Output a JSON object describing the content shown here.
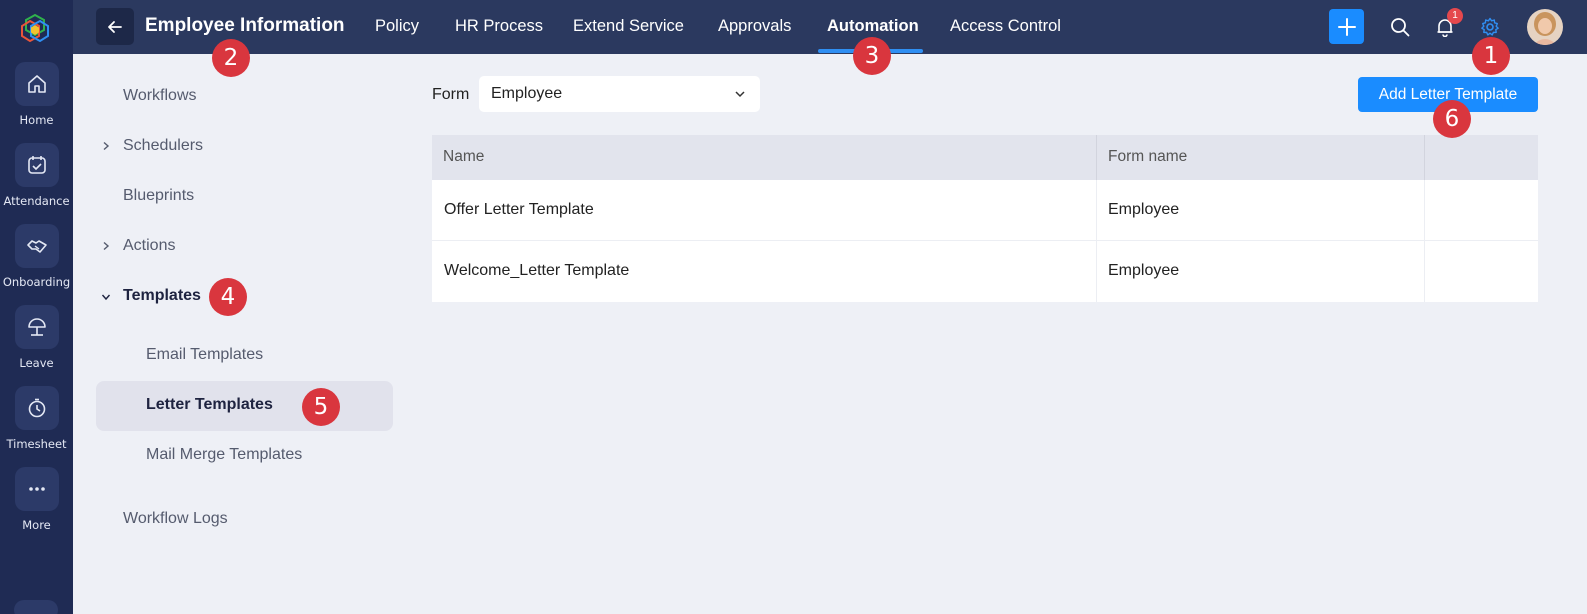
{
  "rail": {
    "items": [
      {
        "label": "Home",
        "icon": "home-icon"
      },
      {
        "label": "Attendance",
        "icon": "calendar-check-icon"
      },
      {
        "label": "Onboarding",
        "icon": "handshake-icon"
      },
      {
        "label": "Leave",
        "icon": "umbrella-icon"
      },
      {
        "label": "Timesheet",
        "icon": "stopwatch-icon"
      },
      {
        "label": "More",
        "icon": "more-dots-icon"
      }
    ]
  },
  "header": {
    "title": "Employee Information",
    "tabs": [
      {
        "label": "Policy",
        "active": false
      },
      {
        "label": "HR Process",
        "active": false
      },
      {
        "label": "Extend Service",
        "active": false
      },
      {
        "label": "Approvals",
        "active": false
      },
      {
        "label": "Automation",
        "active": true
      },
      {
        "label": "Access Control",
        "active": false
      }
    ],
    "notification_count": "1",
    "colors": {
      "bar": "#2b395f",
      "accent": "#1a8cff",
      "badge": "#e5484d"
    }
  },
  "sidebar": {
    "items": [
      {
        "label": "Workflows"
      },
      {
        "label": "Schedulers"
      },
      {
        "label": "Blueprints"
      },
      {
        "label": "Actions"
      },
      {
        "label": "Templates"
      },
      {
        "label": "Email Templates"
      },
      {
        "label": "Letter Templates"
      },
      {
        "label": "Mail Merge Templates"
      },
      {
        "label": "Workflow Logs"
      }
    ]
  },
  "filter": {
    "form_label": "Form",
    "form_value": "Employee"
  },
  "actions": {
    "add_label": "Add Letter Template"
  },
  "table": {
    "columns": [
      "Name",
      "Form name"
    ],
    "rows": [
      {
        "name": "Offer Letter Template",
        "form": "Employee"
      },
      {
        "name": "Welcome_Letter Template",
        "form": "Employee"
      }
    ]
  },
  "markers": [
    "1",
    "2",
    "3",
    "4",
    "5",
    "6"
  ]
}
